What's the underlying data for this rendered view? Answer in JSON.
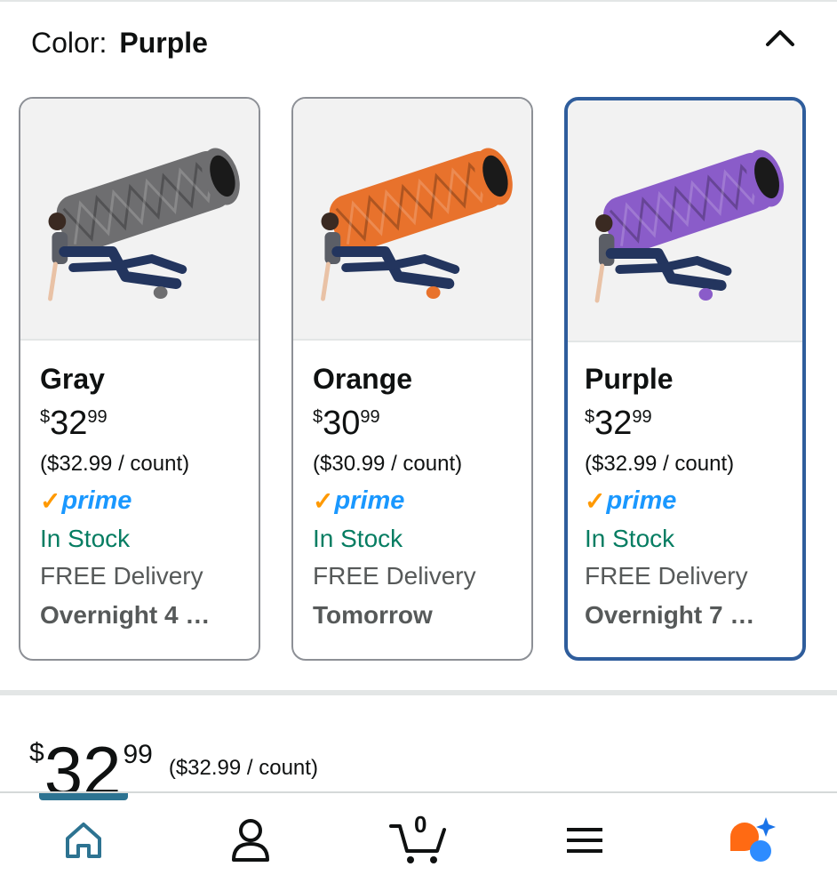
{
  "color_selector": {
    "label": "Color:",
    "selected": "Purple"
  },
  "options": [
    {
      "name": "Gray",
      "color": "#6e6e70",
      "price_symbol": "$",
      "price_dollars": "32",
      "price_cents": "99",
      "unit_price": "($32.99 / count)",
      "prime": "prime",
      "stock": "In Stock",
      "delivery": "FREE Delivery",
      "delivery_date": "Overnight 4 …",
      "selected": false
    },
    {
      "name": "Orange",
      "color": "#e8722c",
      "price_symbol": "$",
      "price_dollars": "30",
      "price_cents": "99",
      "unit_price": "($30.99 / count)",
      "prime": "prime",
      "stock": "In Stock",
      "delivery": "FREE Delivery",
      "delivery_date": "Tomorrow",
      "selected": false
    },
    {
      "name": "Purple",
      "color": "#8a5cc9",
      "price_symbol": "$",
      "price_dollars": "32",
      "price_cents": "99",
      "unit_price": "($32.99 / count)",
      "prime": "prime",
      "stock": "In Stock",
      "delivery": "FREE Delivery",
      "delivery_date": "Overnight 7 …",
      "selected": true
    }
  ],
  "main_price": {
    "symbol": "$",
    "dollars": "32",
    "cents": "99",
    "unit_price": "($32.99 / count)"
  },
  "bottom_nav": {
    "items": [
      "home-icon",
      "account-icon",
      "cart-icon",
      "menu-icon",
      "rufus-icon"
    ],
    "cart_count": "0"
  },
  "colors": {
    "selected_border": "#2f5d9c",
    "prime_blue": "#1a98ff",
    "prime_check": "#ff9900",
    "in_stock": "#067d62",
    "home_active": "#2d7391"
  }
}
